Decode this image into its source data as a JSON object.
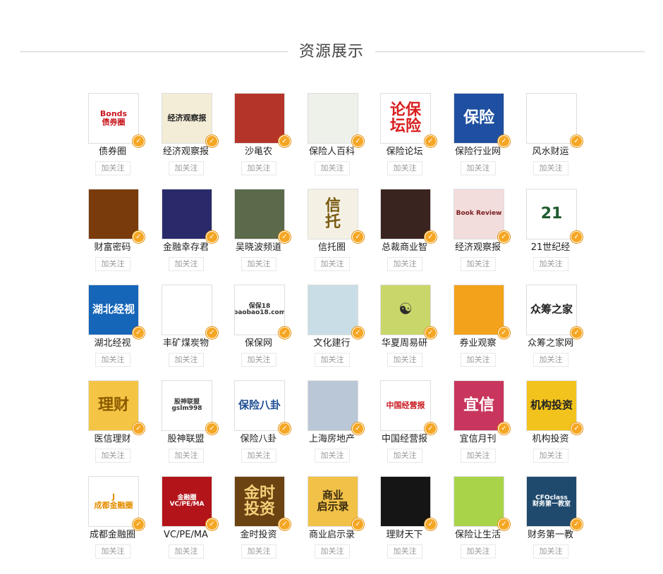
{
  "section": {
    "title": "资源展示"
  },
  "follow_label": "加关注",
  "rows": [
    [
      {
        "name": "债券圈",
        "logo_text": "Bonds\n债券圈",
        "bg": "#ffffff",
        "fg": "#c8161d"
      },
      {
        "name": "经济观察报",
        "logo_text": "经济观察报",
        "bg": "#f3ecd7",
        "fg": "#222222"
      },
      {
        "name": "沙黾农",
        "logo_text": "",
        "bg": "#b5342a",
        "fg": "#ffffff"
      },
      {
        "name": "保险人百科",
        "logo_text": "",
        "bg": "#eef0ea",
        "fg": "#a14fb3"
      },
      {
        "name": "保险论坛",
        "logo_text": "论保\n坛险",
        "bg": "#ffffff",
        "fg": "#d81e1e"
      },
      {
        "name": "保险行业网",
        "logo_text": "保险",
        "bg": "#1f4fa0",
        "fg": "#ffffff"
      },
      {
        "name": "风水财运",
        "logo_text": "",
        "bg": "#ffffff",
        "fg": "#b08428"
      }
    ],
    [
      {
        "name": "财富密码",
        "logo_text": "",
        "bg": "#7a3b0c",
        "fg": "#f7c34a"
      },
      {
        "name": "金融幸存君",
        "logo_text": "",
        "bg": "#2a2a6b",
        "fg": "#d94040"
      },
      {
        "name": "吴晓波频道",
        "logo_text": "",
        "bg": "#5a6a4a",
        "fg": "#ffffff"
      },
      {
        "name": "信托圈",
        "logo_text": "信\n托",
        "bg": "#f4f1e4",
        "fg": "#7a5a10"
      },
      {
        "name": "总裁商业智",
        "logo_text": "",
        "bg": "#3a2420",
        "fg": "#ffffff"
      },
      {
        "name": "经济观察报",
        "logo_text": "Book Review",
        "bg": "#f3dcdc",
        "fg": "#7a1f1f"
      },
      {
        "name": "21世纪经",
        "logo_text": "21",
        "bg": "#ffffff",
        "fg": "#1f5b2e"
      }
    ],
    [
      {
        "name": "湖北经视",
        "logo_text": "湖北经视",
        "bg": "#1565b8",
        "fg": "#ffffff"
      },
      {
        "name": "丰矿煤炭物",
        "logo_text": "",
        "bg": "#ffffff",
        "fg": "#d81e1e"
      },
      {
        "name": "保保网",
        "logo_text": "保保18\nbaobao18.com",
        "bg": "#ffffff",
        "fg": "#333333"
      },
      {
        "name": "文化建行",
        "logo_text": "",
        "bg": "#c9dde6",
        "fg": "#333333"
      },
      {
        "name": "华夏周易研",
        "logo_text": "☯",
        "bg": "#c9d66a",
        "fg": "#2c2c2c"
      },
      {
        "name": "券业观察",
        "logo_text": "",
        "bg": "#f3a21b",
        "fg": "#1b2a48"
      },
      {
        "name": "众筹之家网",
        "logo_text": "众筹之家",
        "bg": "#ffffff",
        "fg": "#222222"
      }
    ],
    [
      {
        "name": "医信理财",
        "logo_text": "理财",
        "bg": "#f4c545",
        "fg": "#8a5a00"
      },
      {
        "name": "股神联盟",
        "logo_text": "股神联盟\ngslm998",
        "bg": "#ffffff",
        "fg": "#333333"
      },
      {
        "name": "保险八卦",
        "logo_text": "保险八卦",
        "bg": "#ffffff",
        "fg": "#1f4f95"
      },
      {
        "name": "上海房地产",
        "logo_text": "",
        "bg": "#b9c7d6",
        "fg": "#333333"
      },
      {
        "name": "中国经营报",
        "logo_text": "中国经营报",
        "bg": "#ffffff",
        "fg": "#c8161d"
      },
      {
        "name": "宜信月刊",
        "logo_text": "宜信",
        "bg": "#c8355d",
        "fg": "#ffffff"
      },
      {
        "name": "机构投资",
        "logo_text": "机构投资",
        "bg": "#f2c31c",
        "fg": "#222222"
      }
    ],
    [
      {
        "name": "成都金融圈",
        "logo_text": "J\n成都金融圈",
        "bg": "#ffffff",
        "fg": "#e58e00"
      },
      {
        "name": "VC/PE/MA",
        "logo_text": "金融圈\nVC/PE/MA",
        "bg": "#b3141a",
        "fg": "#ffffff"
      },
      {
        "name": "金时投资",
        "logo_text": "金时\n投资",
        "bg": "#6b4312",
        "fg": "#f4d07a"
      },
      {
        "name": "商业启示录",
        "logo_text": "商业\n启示录",
        "bg": "#f1c148",
        "fg": "#3a2a10"
      },
      {
        "name": "理财天下",
        "logo_text": "",
        "bg": "#151515",
        "fg": "#d6a733"
      },
      {
        "name": "保险让生活",
        "logo_text": "",
        "bg": "#a9d44a",
        "fg": "#ffffff"
      },
      {
        "name": "财务第一教",
        "logo_text": "CFOclass\n财务第一教室",
        "bg": "#1f4a6e",
        "fg": "#ffffff"
      }
    ]
  ]
}
